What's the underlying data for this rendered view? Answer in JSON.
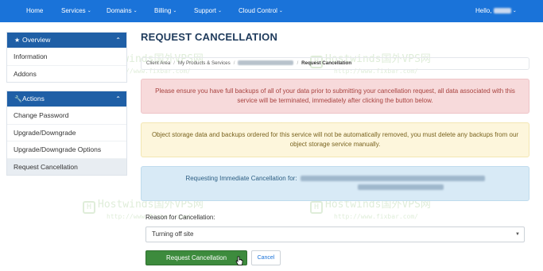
{
  "nav": {
    "items": [
      {
        "label": "Home",
        "dropdown": false
      },
      {
        "label": "Services",
        "dropdown": true
      },
      {
        "label": "Domains",
        "dropdown": true
      },
      {
        "label": "Billing",
        "dropdown": true
      },
      {
        "label": "Support",
        "dropdown": true
      },
      {
        "label": "Cloud Control",
        "dropdown": true
      }
    ],
    "greeting": "Hello,",
    "caret_glyph": "⌄",
    "color": "#1a73d9"
  },
  "sidebar": {
    "overview": {
      "title": "Overview",
      "icon": "star-icon",
      "items": [
        {
          "label": "Information"
        },
        {
          "label": "Addons"
        }
      ]
    },
    "actions": {
      "title": "Actions",
      "icon": "wrench-icon",
      "items": [
        {
          "label": "Change Password"
        },
        {
          "label": "Upgrade/Downgrade"
        },
        {
          "label": "Upgrade/Downgrade Options"
        },
        {
          "label": "Request Cancellation",
          "active": true
        }
      ]
    },
    "header_color": "#1f5fa6"
  },
  "main": {
    "title": "REQUEST CANCELLATION",
    "breadcrumb": {
      "items": [
        "Client Area",
        "My Products & Services"
      ],
      "current": "Request Cancellation",
      "separator": "/"
    },
    "alerts": {
      "danger": "Please ensure you have full backups of all of your data prior to submitting your cancellation request, all data associated with this service will be terminated, immediately after clicking the button below.",
      "warning": "Object storage data and backups ordered for this service will not be automatically removed, you must delete any backups from our object storage service manually.",
      "info": "Requesting Immediate Cancellation for:"
    },
    "reason": {
      "label": "Reason for Cancellation:",
      "selected": "Turning off site"
    },
    "buttons": {
      "submit": "Request Cancellation",
      "cancel": "Cancel",
      "submit_color": "#3d8b3d"
    }
  },
  "watermark": {
    "text": "Hostwinds国外VPS网",
    "url": "http://www.fixbar.com/",
    "logo": "H"
  }
}
